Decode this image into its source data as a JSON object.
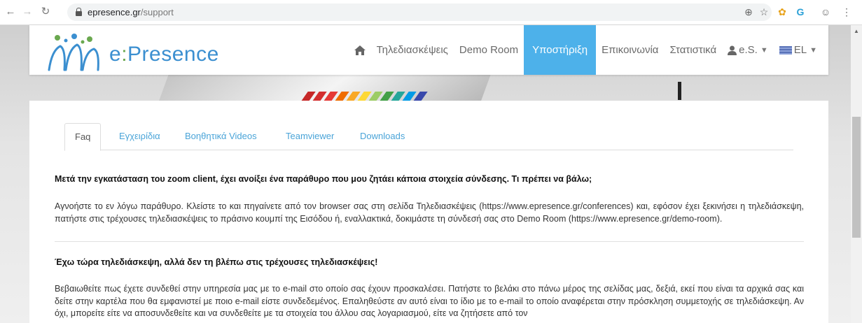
{
  "browser": {
    "domain": "epresence.gr",
    "path": "/support"
  },
  "header": {
    "logo_prefix": "e",
    "logo_colon": ":",
    "logo_suffix": "Presence",
    "nav": {
      "conferences": "Τηλεδιασκέψεις",
      "demo_room": "Demo Room",
      "support": "Υποστήριξη",
      "contact": "Επικοινωνία",
      "statistics": "Στατιστικά",
      "user": "e.S.",
      "language": "EL"
    }
  },
  "tabs": [
    "Faq",
    "Εγχειρίδια",
    "Βοηθητικά Videos",
    "Teamviewer",
    "Downloads"
  ],
  "faq": [
    {
      "question": "Μετά την εγκατάσταση του zoom client, έχει ανοίξει ένα παράθυρο που μου ζητάει κάποια στοιχεία σύνδεσης. Τι πρέπει να βάλω;",
      "answer": "Αγνοήστε το εν λόγω παράθυρο. Κλείστε το και πηγαίνετε από τον browser σας στη σελίδα Τηλεδιασκέψεις (https://www.epresence.gr/conferences) και, εφόσον έχει ξεκινήσει η τηλεδιάσκεψη, πατήστε στις τρέχουσες τηλεδιασκέψεις το πράσινο κουμπί της Εισόδου ή, εναλλακτικά, δοκιμάστε τη σύνδεσή σας στο Demo Room (https://www.epresence.gr/demo-room)."
    },
    {
      "question": "Έχω τώρα τηλεδιάσκεψη, αλλά δεν τη βλέπω στις τρέχουσες τηλεδιασκέψεις!",
      "answer": "Βεβαιωθείτε πως έχετε συνδεθεί στην υπηρεσία μας με το e-mail στο οποίο σας έχουν προσκαλέσει. Πατήστε το βελάκι στο πάνω μέρος της σελίδας μας, δεξιά, εκεί που είναι τα αρχικά σας και δείτε στην καρτέλα που θα εμφανιστεί με ποιο e-mail είστε συνδεδεμένος. Επαληθεύστε αν αυτό είναι το ίδιο με το e-mail το οποίο αναφέρεται στην πρόσκληση συμμετοχής σε τηλεδιάσκεψη. Αν όχι, μπορείτε είτε να αποσυνδεθείτε και να συνδεθείτε με τα στοιχεία του άλλου σας λογαριασμού, είτε να ζητήσετε από τον"
    }
  ],
  "colors": {
    "accent": "#4db1ea",
    "link": "#4aa4d8",
    "logo": "#3b8fd0"
  }
}
